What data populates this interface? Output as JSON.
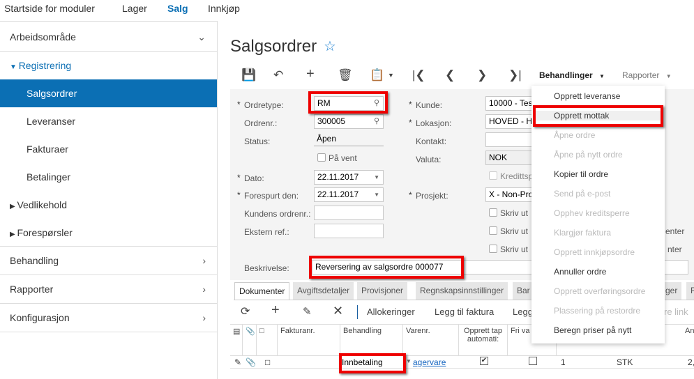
{
  "topnav": [
    "Startside for moduler",
    "Lager",
    "Salg",
    "Innkjøp"
  ],
  "sidebar": {
    "workspace": "Arbeidsområde",
    "registrering": "Registrering",
    "items": [
      "Salgsordrer",
      "Leveranser",
      "Fakturaer",
      "Betalinger"
    ],
    "vedlikehold": "Vedlikehold",
    "foresporsler": "Forespørsler",
    "behandling": "Behandling",
    "rapporter": "Rapporter",
    "konfigurasjon": "Konfigurasjon"
  },
  "page": {
    "title": "Salgsordrer"
  },
  "toolbar": {
    "behandlinger": "Behandlinger",
    "rapporter": "Rapporter"
  },
  "form": {
    "ordretype_label": "Ordretype:",
    "ordretype": "RM",
    "ordrenr_label": "Ordrenr.:",
    "ordrenr": "300005",
    "status_label": "Status:",
    "status": "Åpen",
    "pavent": "På vent",
    "dato_label": "Dato:",
    "dato": "22.11.2017",
    "forespurt_label": "Forespurt den:",
    "forespurt": "22.11.2017",
    "kundens_label": "Kundens ordrenr.:",
    "ekstern_label": "Ekstern ref.:",
    "beskrivelse_label": "Beskrivelse:",
    "beskrivelse": "Reversering av salgsordre 000077",
    "kunde_label": "Kunde:",
    "kunde": "10000 - Tes",
    "lokasjon_label": "Lokasjon:",
    "lokasjon": "HOVED - H",
    "kontakt_label": "Kontakt:",
    "valuta_label": "Valuta:",
    "valuta": "NOK",
    "kreditt": "Kredittsp",
    "prosjekt_label": "Prosjekt:",
    "prosjekt": "X - Non-Pro",
    "skriv1": "Skriv ut",
    "skriv2": "Skriv ut",
    "skriv3": "Skriv ut",
    "enter1": "enter",
    "enter2": "nter"
  },
  "tabs": [
    "Dokumenter",
    "Avgiftsdetaljer",
    "Provisjoner",
    "Regnskapsinnstillinger",
    "Bar",
    "ger",
    "R"
  ],
  "grid_toolbar": {
    "allokeringer": "Allokeringer",
    "legg_faktura": "Legg til faktura",
    "legg": "Legg",
    "link": "re link"
  },
  "grid": {
    "headers": [
      "Fakturanr.",
      "Behandling",
      "Varenr.",
      "Opprett tap automati:",
      "Fri va",
      "An"
    ],
    "row": {
      "behandling": "Innbetaling",
      "varenr": "agervare",
      "antall": "1",
      "enhet": "STK",
      "belop": "2,"
    }
  },
  "menu": [
    {
      "label": "Opprett leveranse",
      "enabled": true
    },
    {
      "label": "Opprett mottak",
      "enabled": true
    },
    {
      "label": "Åpne ordre",
      "enabled": false
    },
    {
      "label": "Åpne på nytt ordre",
      "enabled": false
    },
    {
      "label": "Kopier til ordre",
      "enabled": true
    },
    {
      "label": "Send på e-post",
      "enabled": false
    },
    {
      "label": "Opphev kreditsperre",
      "enabled": false
    },
    {
      "label": "Klargjør faktura",
      "enabled": false
    },
    {
      "label": "Opprett innkjøpsordre",
      "enabled": false
    },
    {
      "label": "Annuller ordre",
      "enabled": true
    },
    {
      "label": "Opprett overføringsordre",
      "enabled": false
    },
    {
      "label": "Plassering på restordre",
      "enabled": false
    },
    {
      "label": "Beregn priser på nytt",
      "enabled": true
    }
  ],
  "colors": {
    "accent": "#0b6fb4",
    "highlight": "#e00000"
  }
}
